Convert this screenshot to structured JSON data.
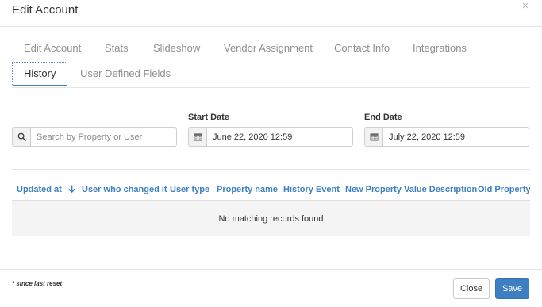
{
  "modal": {
    "title": "Edit Account",
    "close_glyph": "×"
  },
  "tabs": [
    {
      "label": "Edit Account"
    },
    {
      "label": "Stats"
    },
    {
      "label": "Slideshow"
    },
    {
      "label": "Vendor Assignment"
    },
    {
      "label": "Contact Info"
    },
    {
      "label": "Integrations"
    },
    {
      "label": "History",
      "active": true
    },
    {
      "label": "User Defined Fields"
    }
  ],
  "filters": {
    "search": {
      "placeholder": "Search by Property or User",
      "value": "",
      "icon": "search-icon"
    },
    "start_date": {
      "label": "Start Date",
      "value": "June 22, 2020 12:59",
      "icon": "calendar-icon"
    },
    "end_date": {
      "label": "End Date",
      "value": "July 22, 2020 12:59",
      "icon": "calendar-icon"
    }
  },
  "table": {
    "columns": [
      {
        "label": "Updated at",
        "sort": "descending",
        "sort_icon": "arrow-down-icon"
      },
      {
        "label": "User who changed it"
      },
      {
        "label": "User type"
      },
      {
        "label": "Property name"
      },
      {
        "label": "History Event"
      },
      {
        "label": "New Property Value Description"
      },
      {
        "label": "Old Property Value Description"
      }
    ],
    "empty_message": "No matching records found"
  },
  "footer": {
    "note": "* since last reset",
    "close_label": "Close",
    "save_label": "Save"
  },
  "colors": {
    "accent": "#3d7fc1",
    "muted_tab": "#8f8f8f",
    "empty_row_bg": "#f4f4f4"
  }
}
